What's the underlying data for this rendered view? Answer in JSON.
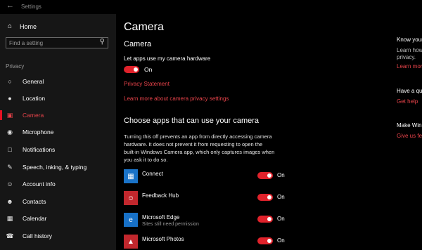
{
  "window": {
    "title": "Settings",
    "back_icon": "back-arrow-icon"
  },
  "sidebar": {
    "home_label": "Home",
    "search_placeholder": "Find a setting",
    "section_label": "Privacy",
    "items": [
      {
        "label": "General",
        "icon": "lock-icon"
      },
      {
        "label": "Location",
        "icon": "location-icon"
      },
      {
        "label": "Camera",
        "icon": "camera-icon",
        "active": true
      },
      {
        "label": "Microphone",
        "icon": "microphone-icon"
      },
      {
        "label": "Notifications",
        "icon": "notifications-icon"
      },
      {
        "label": "Speech, inking, & typing",
        "icon": "speech-icon"
      },
      {
        "label": "Account info",
        "icon": "account-icon"
      },
      {
        "label": "Contacts",
        "icon": "contacts-icon"
      },
      {
        "label": "Calendar",
        "icon": "calendar-icon"
      },
      {
        "label": "Call history",
        "icon": "call-history-icon"
      }
    ]
  },
  "main": {
    "page_title": "Camera",
    "section1_title": "Camera",
    "hardware_label": "Let apps use my camera hardware",
    "hardware_toggle": "On",
    "privacy_statement": "Privacy Statement",
    "learn_more": "Learn more about camera privacy settings",
    "section2_title": "Choose apps that can use your camera",
    "description": "Turning this off prevents an app from directly accessing camera hardware. It does not prevent it from requesting to open the built-in Windows Camera app, which only captures images when you ask it to do so.",
    "apps": [
      {
        "name": "Connect",
        "subtitle": "",
        "state": "On",
        "tile_color": "#1a73c8",
        "icon": "connect-icon"
      },
      {
        "name": "Feedback Hub",
        "subtitle": "",
        "state": "On",
        "tile_color": "#c1272d",
        "icon": "feedback-hub-icon"
      },
      {
        "name": "Microsoft Edge",
        "subtitle": "Sites still need permission",
        "state": "On",
        "tile_color": "#1770c6",
        "icon": "edge-icon"
      },
      {
        "name": "Microsoft Photos",
        "subtitle": "",
        "state": "On",
        "tile_color": "#c1272d",
        "icon": "photos-icon"
      }
    ]
  },
  "right_panel": {
    "know_title": "Know your",
    "know_line1": "Learn how",
    "know_line2": "privacy.",
    "know_link": "Learn more",
    "question_title": "Have a que",
    "get_help": "Get help",
    "make_title": "Make Wind",
    "feedback_link": "Give us fee"
  },
  "colors": {
    "accent": "#e81123",
    "link": "#e8434a",
    "toggle_on": "#e0222b"
  }
}
